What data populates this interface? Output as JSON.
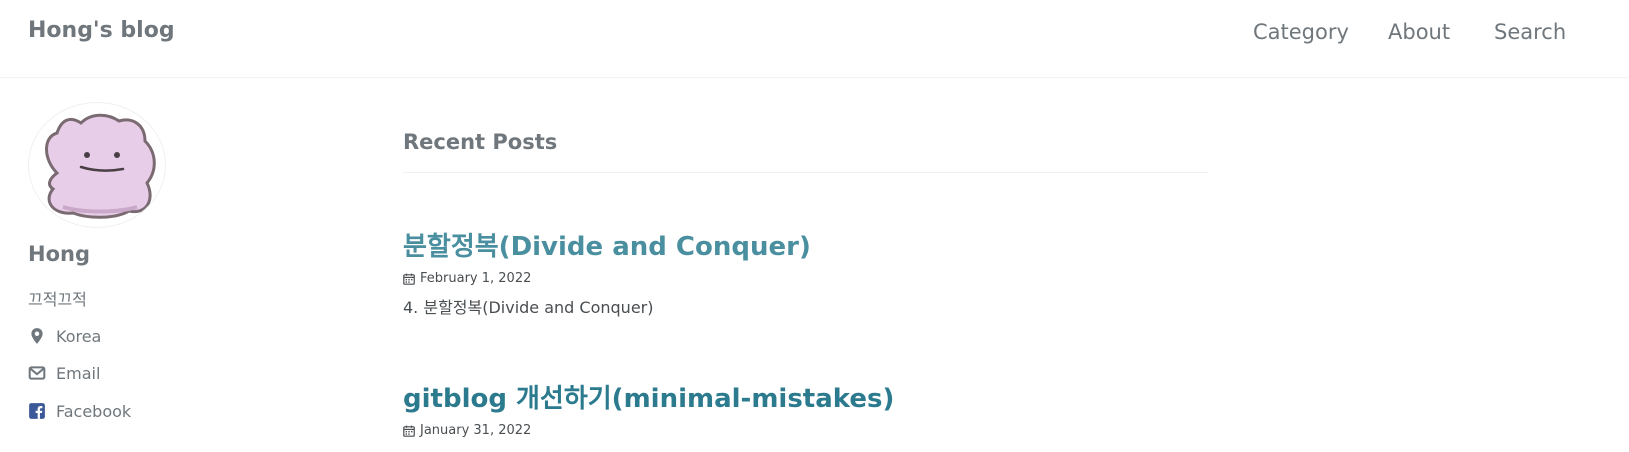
{
  "header": {
    "site_title": "Hong's blog",
    "nav": [
      {
        "label": "Category"
      },
      {
        "label": "About"
      },
      {
        "label": "Search"
      }
    ]
  },
  "sidebar": {
    "author_name": "Hong",
    "author_bio": "끄적끄적",
    "links": [
      {
        "label": "Korea",
        "icon": "map-marker-icon"
      },
      {
        "label": "Email",
        "icon": "envelope-icon"
      },
      {
        "label": "Facebook",
        "icon": "facebook-square-icon"
      }
    ]
  },
  "main": {
    "section_title": "Recent Posts",
    "posts": [
      {
        "title": "분할정복(Divide and Conquer)",
        "date": "February 1, 2022",
        "excerpt": "4. 분할정복(Divide and Conquer)"
      },
      {
        "title": "gitblog 개선하기(minimal-mistakes)",
        "date": "January 31, 2022"
      }
    ]
  },
  "colors": {
    "post_title": "#4a8fa0",
    "post_title_dark": "#2b7a8e",
    "muted_text": "#6f777d",
    "avatar_body": "#e8cde8",
    "facebook_blue": "#3b5998"
  }
}
